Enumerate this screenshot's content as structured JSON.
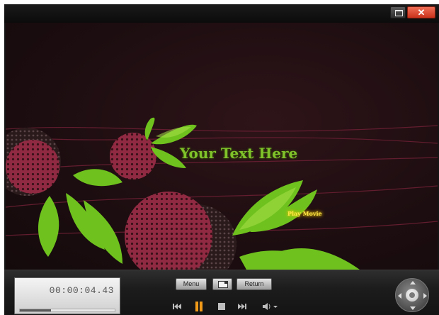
{
  "window": {
    "restore_icon": "restore-window-icon",
    "close_icon": "close-icon",
    "close_glyph": "✕"
  },
  "video": {
    "title_text": "Your Text Here",
    "play_button_label": "Play Movie"
  },
  "controls": {
    "time_display": "00:00:04.43",
    "progress_fraction": 0.33,
    "menu_label": "Menu",
    "pip_icon": "picture-in-picture-icon",
    "return_label": "Return",
    "playback_icons": [
      "previous-chapter-icon",
      "pause-icon",
      "stop-icon",
      "next-chapter-icon",
      "volume-icon"
    ],
    "navigator_icon": "navigation-dpad-icon"
  },
  "colors": {
    "pause_accent": "#f19a1a",
    "close_red": "#d43a22",
    "title_green": "#7fc22a",
    "play_yellow": "#ffe74a"
  }
}
